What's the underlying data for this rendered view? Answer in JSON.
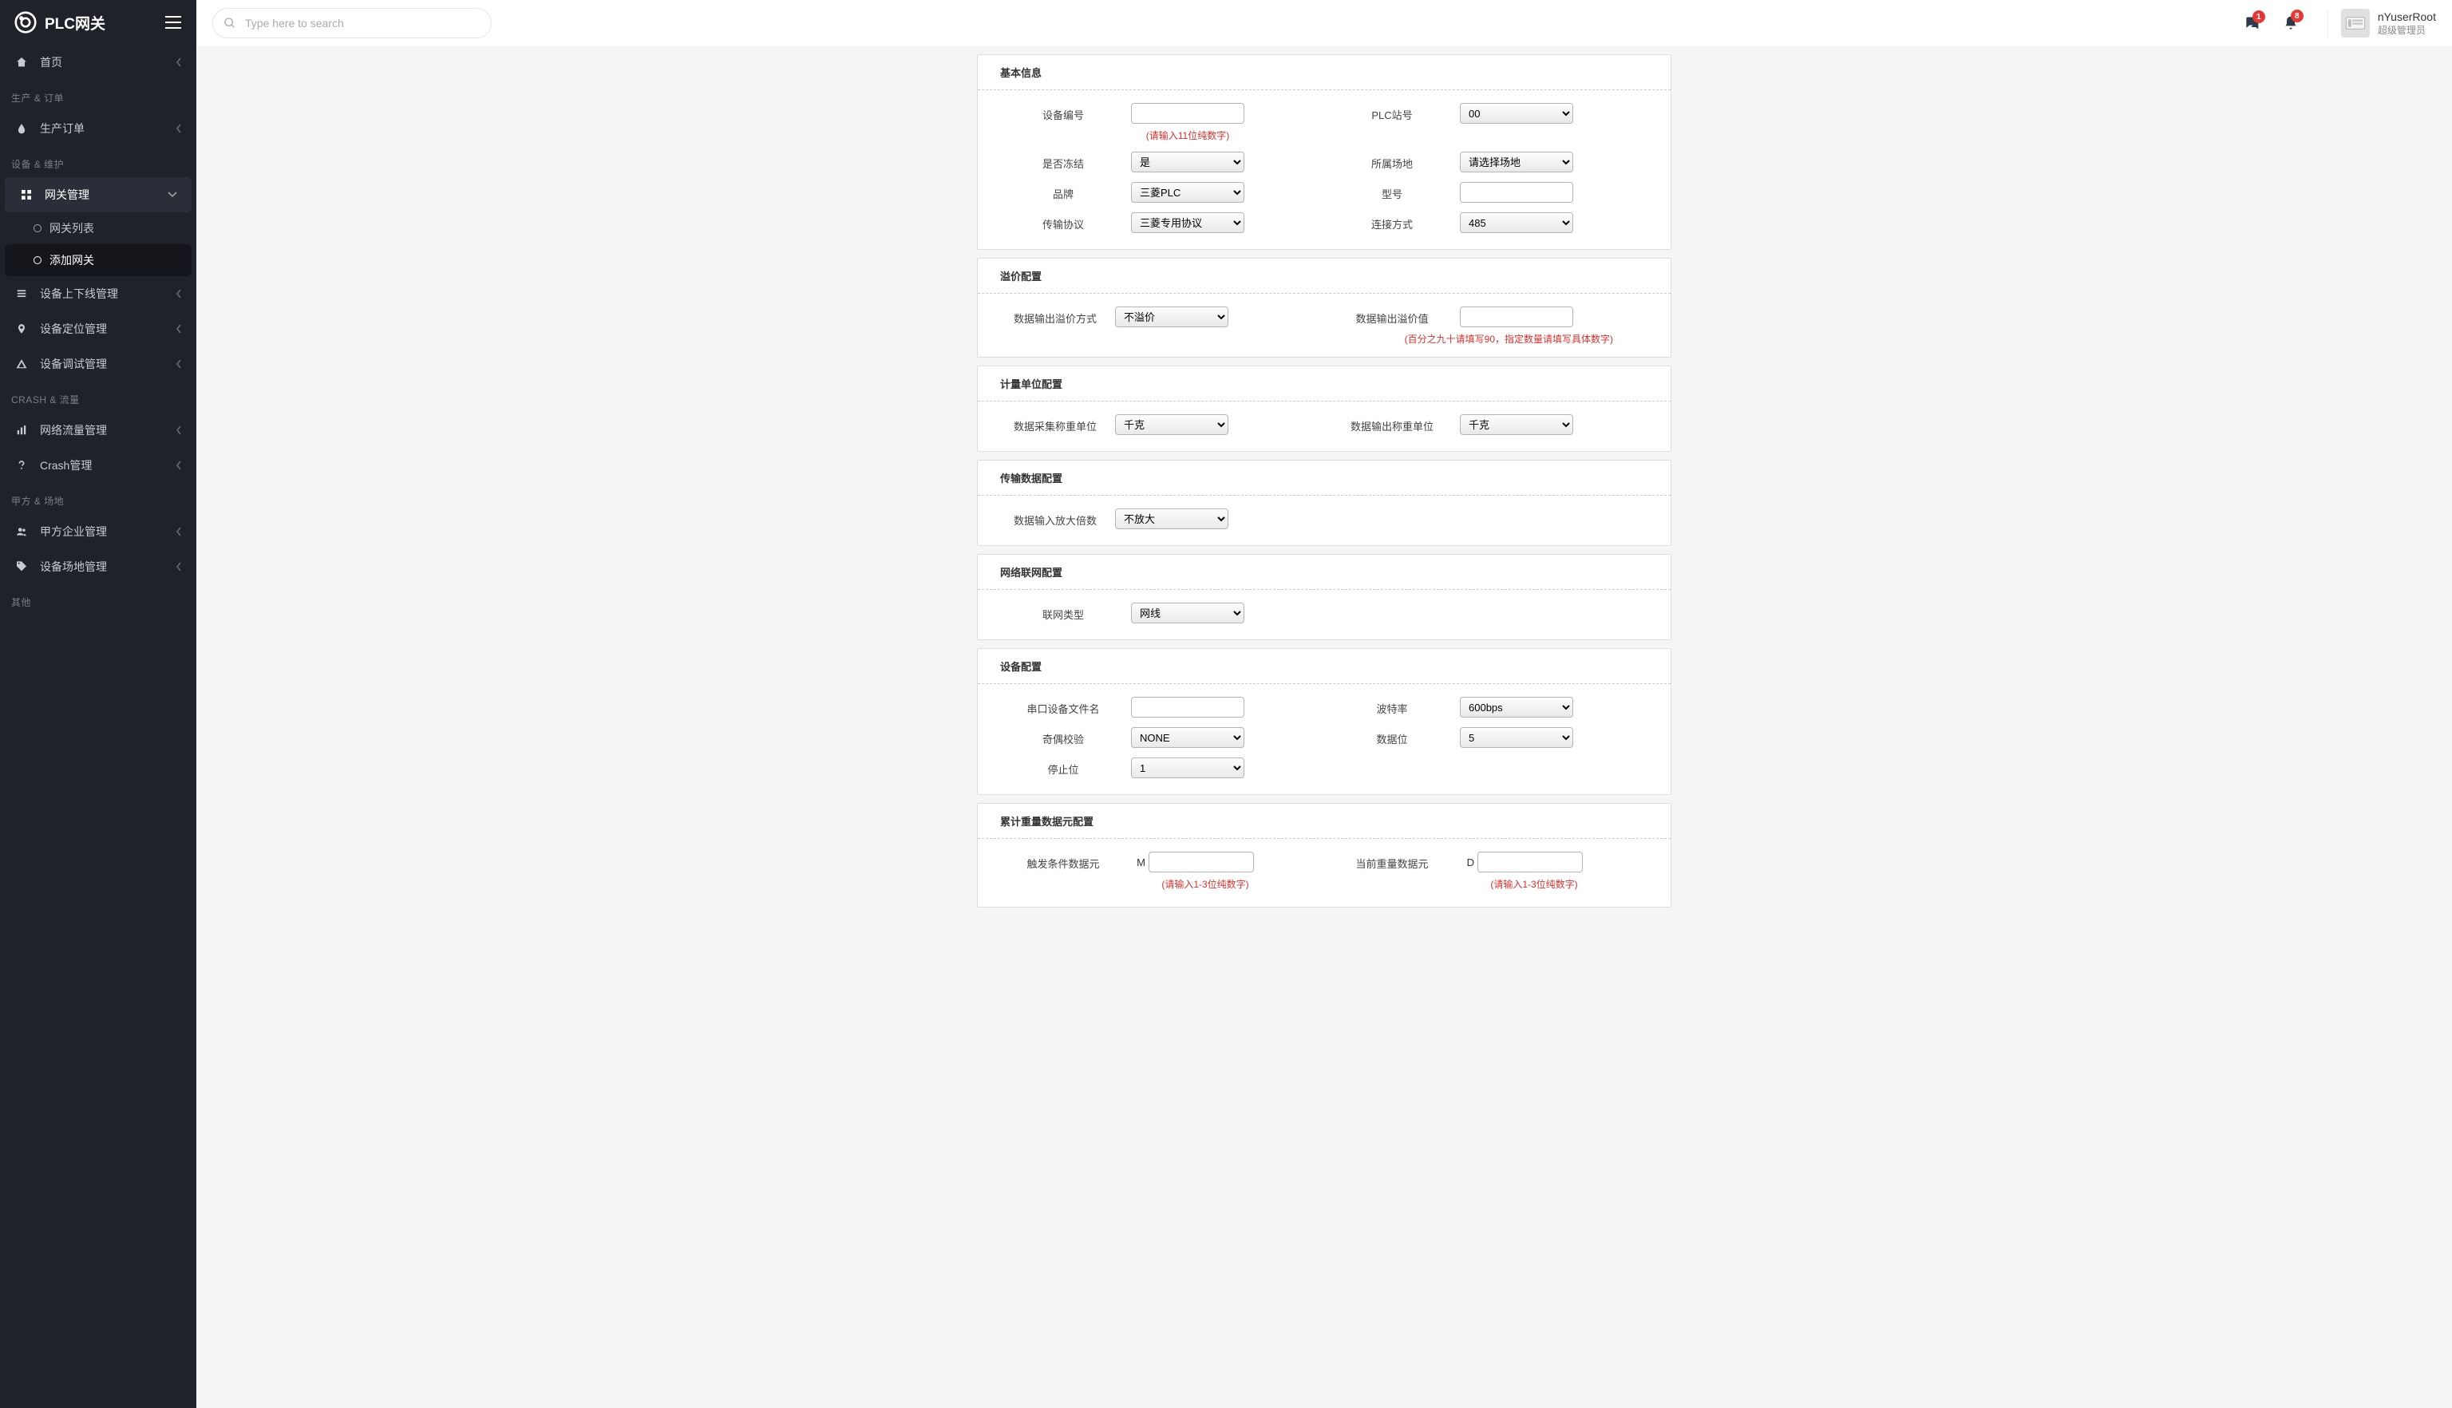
{
  "brand": "PLC网关",
  "search_placeholder": "Type here to search",
  "notifications": {
    "chat_count": "1",
    "bell_count": "8"
  },
  "user": {
    "name": "nYuserRoot",
    "role": "超级管理员"
  },
  "sidebar": {
    "home": "首页",
    "sec_production": "生产 & 订单",
    "production_orders": "生产订单",
    "sec_device": "设备 & 维护",
    "gateway_mgmt": "网关管理",
    "gateway_list": "网关列表",
    "gateway_add": "添加网关",
    "device_online": "设备上下线管理",
    "device_location": "设备定位管理",
    "device_debug": "设备调试管理",
    "sec_crash": "CRASH & 流量",
    "traffic": "网络流量管理",
    "crash": "Crash管理",
    "sec_party": "甲方 & 场地",
    "enterprise": "甲方企业管理",
    "site": "设备场地管理",
    "sec_other": "其他"
  },
  "sections": {
    "basic": {
      "title": "基本信息",
      "device_no": "设备编号",
      "device_no_hint": "(请输入11位纯数字)",
      "plc_station": "PLC站号",
      "plc_station_val": "00",
      "frozen": "是否冻结",
      "frozen_val": "是",
      "site": "所属场地",
      "site_val": "请选择场地",
      "brand": "品牌",
      "brand_val": "三菱PLC",
      "model": "型号",
      "protocol": "传输协议",
      "protocol_val": "三菱专用协议",
      "connection": "连接方式",
      "connection_val": "485"
    },
    "overflow": {
      "title": "溢价配置",
      "method": "数据输出溢价方式",
      "method_val": "不溢价",
      "value": "数据输出溢价值",
      "value_hint": "(百分之九十请填写90，指定数量请填写具体数字)"
    },
    "unit": {
      "title": "计量单位配置",
      "collect": "数据采集称重单位",
      "collect_val": "千克",
      "output": "数据输出称重单位",
      "output_val": "千克"
    },
    "transfer": {
      "title": "传输数据配置",
      "amplify": "数据输入放大倍数",
      "amplify_val": "不放大"
    },
    "network": {
      "title": "网络联网配置",
      "type": "联网类型",
      "type_val": "网线"
    },
    "device": {
      "title": "设备配置",
      "serial_file": "串口设备文件名",
      "baud": "波特率",
      "baud_val": "600bps",
      "parity": "奇偶校验",
      "parity_val": "NONE",
      "databits": "数据位",
      "databits_val": "5",
      "stopbits": "停止位",
      "stopbits_val": "1"
    },
    "accum": {
      "title": "累计重量数据元配置",
      "trigger": "触发条件数据元",
      "trigger_prefix": "M",
      "trigger_hint": "(请输入1-3位纯数字)",
      "current": "当前重量数据元",
      "current_prefix": "D",
      "current_hint": "(请输入1-3位纯数字)"
    }
  }
}
